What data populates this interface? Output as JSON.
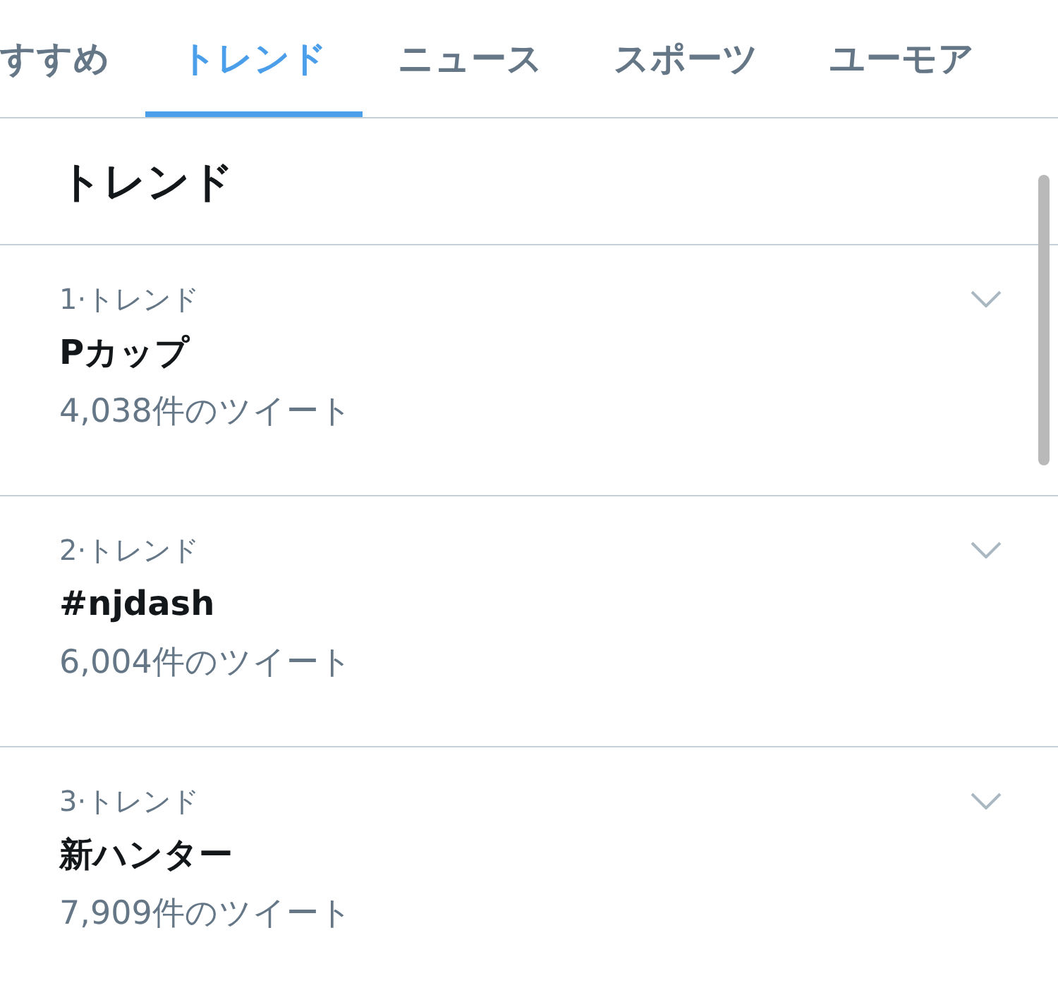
{
  "tabs": [
    {
      "label": "すすめ",
      "selected": false
    },
    {
      "label": "トレンド",
      "selected": true
    },
    {
      "label": "ニュース",
      "selected": false
    },
    {
      "label": "スポーツ",
      "selected": false
    },
    {
      "label": "ユーモア",
      "selected": false
    }
  ],
  "section": {
    "title": "トレンド"
  },
  "trends": [
    {
      "meta": "1·トレンド",
      "name": "Pカップ",
      "count": "4,038件のツイート"
    },
    {
      "meta": "2·トレンド",
      "name": "#njdash",
      "count": "6,004件のツイート"
    },
    {
      "meta": "3·トレンド",
      "name": "新ハンター",
      "count": "7,909件のツイート"
    }
  ]
}
